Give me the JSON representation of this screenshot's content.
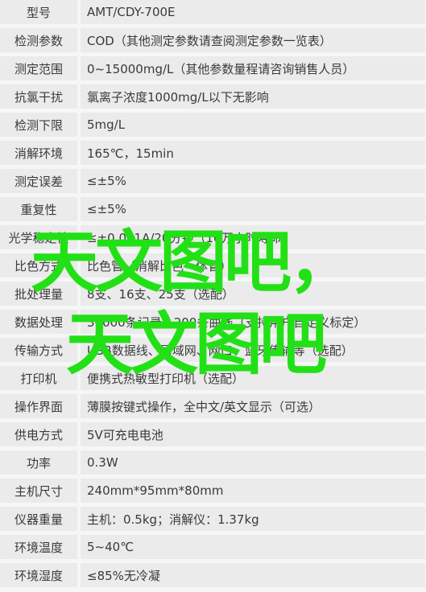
{
  "specs": [
    {
      "k": "型号",
      "v": "AMT/CDY-700E"
    },
    {
      "k": "检测参数",
      "v": "COD（其他测定参数请查阅测定参数一览表）"
    },
    {
      "k": "测定范围",
      "v": "0~15000mg/L（其他参数量程请咨询销售人员）"
    },
    {
      "k": "抗氯干扰",
      "v": "氯离子浓度1000mg/L以下无影响"
    },
    {
      "k": "检测下限",
      "v": "5mg/L"
    },
    {
      "k": "消解环境",
      "v": "165℃，15min"
    },
    {
      "k": "测定误差",
      "v": "≤±5%"
    },
    {
      "k": "重复性",
      "v": "≤±5%"
    },
    {
      "k": "光学稳定性",
      "v": "≤±0.001A/20分钟（10万小时寿命）"
    },
    {
      "k": "比色方式",
      "v": "比色管（消解比色一体管）"
    },
    {
      "k": "批处理量",
      "v": "8支、16支、25支（选配）"
    },
    {
      "k": "数据处理",
      "v": "30000条记录，200条曲线（支持用户自定义标定）"
    },
    {
      "k": "传输方式",
      "v": "USB数据线、局域网、网口、蓝牙传输等（选配）"
    },
    {
      "k": "打印机",
      "v": "便携式热敏型打印机（选配）"
    },
    {
      "k": "操作界面",
      "v": "薄膜按键式操作，全中文/英文显示（可选）"
    },
    {
      "k": "供电方式",
      "v": "5V可充电电池"
    },
    {
      "k": "功率",
      "v": "0.3W"
    },
    {
      "k": "主机尺寸",
      "v": "240mm*95mm*80mm"
    },
    {
      "k": "仪器重量",
      "v": "主机：0.5kg；消解仪：1.37kg"
    },
    {
      "k": "环境温度",
      "v": "5~40℃"
    },
    {
      "k": "环境湿度",
      "v": "≤85%无冷凝"
    }
  ],
  "watermark": {
    "line1": "天文图吧，",
    "line2": "天文图吧",
    "color": "#22e016"
  }
}
